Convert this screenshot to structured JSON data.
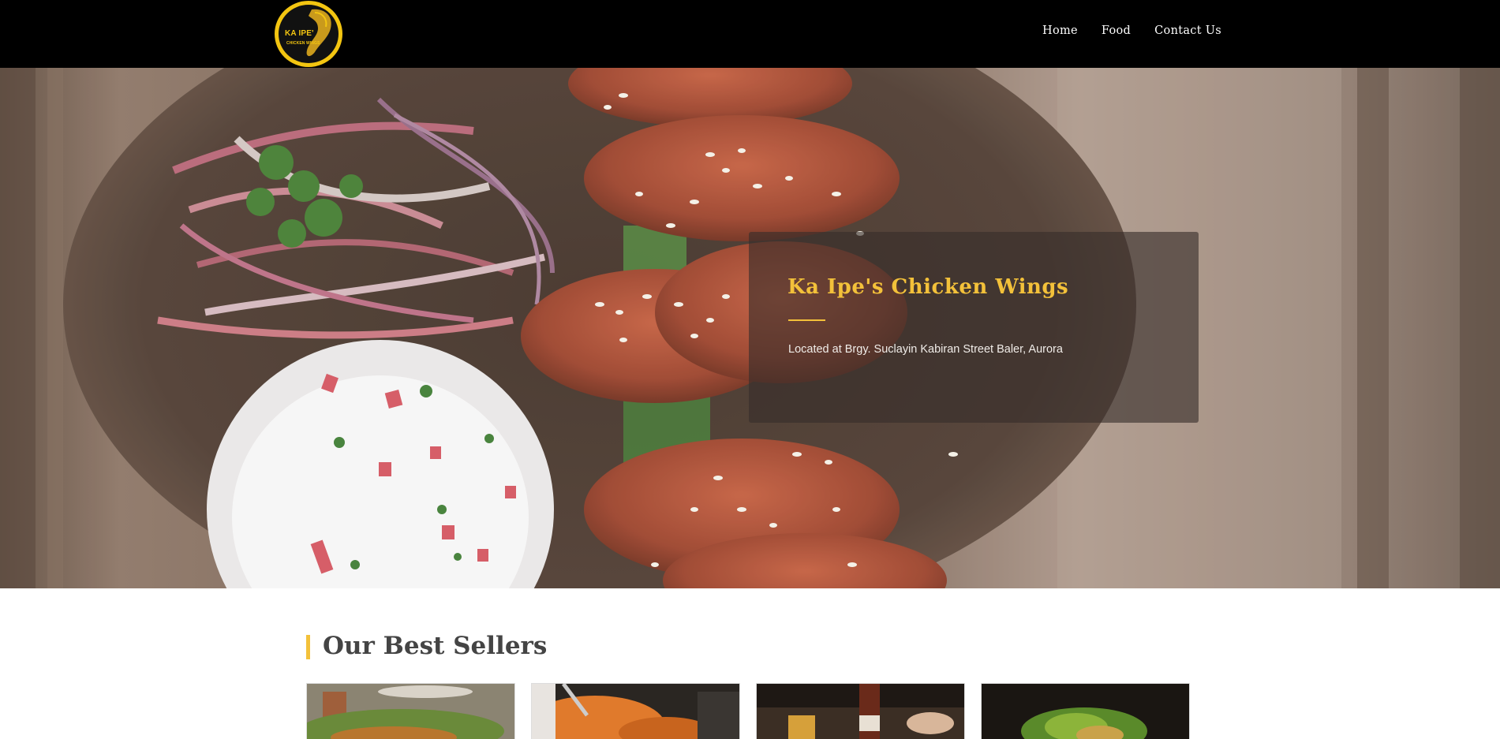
{
  "navbar": {
    "logo": {
      "line1": "KA IPE'",
      "line2": "CHICKEN WINGS",
      "icon": "chicken-wing-logo"
    },
    "links": [
      {
        "label": "Home"
      },
      {
        "label": "Food"
      },
      {
        "label": "Contact Us"
      }
    ]
  },
  "hero": {
    "title": "Ka Ipe's Chicken Wings",
    "subtitle": "Located at Brgy. Suclayin Kabiran Street Baler, Aurora"
  },
  "best_sellers": {
    "title": "Our Best Sellers",
    "cards": [
      {
        "image": "fried-chicken-plate-photo"
      },
      {
        "image": "fried-chicken-tongs-photo"
      },
      {
        "image": "beer-bottle-photo"
      },
      {
        "image": "salad-bowl-photo"
      }
    ]
  },
  "colors": {
    "accent": "#f3c13a",
    "navbar_bg": "#000000",
    "heading_text": "#444444"
  }
}
